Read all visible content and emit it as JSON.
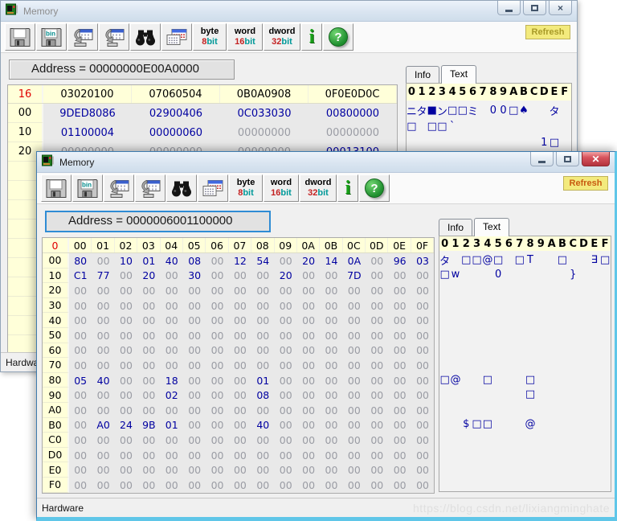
{
  "toolbar": {
    "bin_label": "bin",
    "byte": {
      "label": "byte",
      "num": "8",
      "unit": "bit"
    },
    "word": {
      "label": "word",
      "num": "16",
      "unit": "bit"
    },
    "dword": {
      "label": "dword",
      "num": "32",
      "unit": "bit"
    },
    "refresh_label": "Refresh"
  },
  "colors": {
    "value_navy": "#0000A0",
    "zero_gray": "#9A9CA4",
    "header_red": "#E00000",
    "header_bg_yellow": "#FFFFD9",
    "refresh_bg": "#F3EA7D",
    "focus_blue": "#2F8CD4"
  },
  "back_window": {
    "title": "Memory",
    "address": "Address = 00000000E00A0000",
    "tabs": {
      "info": "Info",
      "text": "Text"
    },
    "status": "Hardware",
    "table": {
      "addr_header": "16",
      "col_headers": [
        "03020100",
        "07060504",
        "0B0A0908",
        "0F0E0D0C"
      ],
      "rows": [
        {
          "addr": "00",
          "cells": [
            "9DED8086",
            "02900406",
            "0C033030",
            "00800000"
          ]
        },
        {
          "addr": "10",
          "cells": [
            "01100004",
            "00000060",
            "00000000",
            "00000000"
          ]
        },
        {
          "addr": "20",
          "cells": [
            "00000000",
            "00000000",
            "00000000",
            "00013100"
          ]
        },
        {
          "addr": "",
          "cells": [
            "",
            "",
            "",
            ""
          ]
        },
        {
          "addr": "",
          "cells": [
            "",
            "",
            "",
            ""
          ]
        },
        {
          "addr": "",
          "cells": [
            "",
            "",
            "",
            ""
          ]
        },
        {
          "addr": "",
          "cells": [
            "",
            "",
            "",
            ""
          ]
        },
        {
          "addr": "",
          "cells": [
            "",
            "",
            "",
            ""
          ]
        },
        {
          "addr": "",
          "cells": [
            "",
            "",
            "",
            ""
          ]
        },
        {
          "addr": "",
          "cells": [
            "",
            "",
            "",
            ""
          ]
        },
        {
          "addr": "",
          "cells": [
            "",
            "",
            "",
            ""
          ]
        },
        {
          "addr": "",
          "cells": [
            "",
            "",
            "",
            ""
          ]
        },
        {
          "addr": "",
          "cells": [
            "",
            "",
            "",
            ""
          ]
        }
      ]
    },
    "text_panel": {
      "header": "0123456789ABCDEF",
      "rows": [
        "ニタ■ン□□ミ 00□♠  タ ",
        "□ □□`           ",
        "             1□ "
      ]
    }
  },
  "front_window": {
    "title": "Memory",
    "address": "Address = 0000006001100000",
    "tabs": {
      "info": "Info",
      "text": "Text"
    },
    "status": "Hardware",
    "watermark": "https://blog.csdn.net/lixiangminghate",
    "table": {
      "addr_header": "0",
      "col_headers": [
        "00",
        "01",
        "02",
        "03",
        "04",
        "05",
        "06",
        "07",
        "08",
        "09",
        "0A",
        "0B",
        "0C",
        "0D",
        "0E",
        "0F"
      ],
      "rows": [
        {
          "addr": "00",
          "cells": [
            "80",
            "00",
            "10",
            "01",
            "40",
            "08",
            "00",
            "12",
            "54",
            "00",
            "20",
            "14",
            "0A",
            "00",
            "96",
            "03"
          ]
        },
        {
          "addr": "10",
          "cells": [
            "C1",
            "77",
            "00",
            "20",
            "00",
            "30",
            "00",
            "00",
            "00",
            "20",
            "00",
            "00",
            "7D",
            "00",
            "00",
            "00"
          ]
        },
        {
          "addr": "20",
          "cells": [
            "00",
            "00",
            "00",
            "00",
            "00",
            "00",
            "00",
            "00",
            "00",
            "00",
            "00",
            "00",
            "00",
            "00",
            "00",
            "00"
          ]
        },
        {
          "addr": "30",
          "cells": [
            "00",
            "00",
            "00",
            "00",
            "00",
            "00",
            "00",
            "00",
            "00",
            "00",
            "00",
            "00",
            "00",
            "00",
            "00",
            "00"
          ]
        },
        {
          "addr": "40",
          "cells": [
            "00",
            "00",
            "00",
            "00",
            "00",
            "00",
            "00",
            "00",
            "00",
            "00",
            "00",
            "00",
            "00",
            "00",
            "00",
            "00"
          ]
        },
        {
          "addr": "50",
          "cells": [
            "00",
            "00",
            "00",
            "00",
            "00",
            "00",
            "00",
            "00",
            "00",
            "00",
            "00",
            "00",
            "00",
            "00",
            "00",
            "00"
          ]
        },
        {
          "addr": "60",
          "cells": [
            "00",
            "00",
            "00",
            "00",
            "00",
            "00",
            "00",
            "00",
            "00",
            "00",
            "00",
            "00",
            "00",
            "00",
            "00",
            "00"
          ]
        },
        {
          "addr": "70",
          "cells": [
            "00",
            "00",
            "00",
            "00",
            "00",
            "00",
            "00",
            "00",
            "00",
            "00",
            "00",
            "00",
            "00",
            "00",
            "00",
            "00"
          ]
        },
        {
          "addr": "80",
          "cells": [
            "05",
            "40",
            "00",
            "00",
            "18",
            "00",
            "00",
            "00",
            "01",
            "00",
            "00",
            "00",
            "00",
            "00",
            "00",
            "00"
          ]
        },
        {
          "addr": "90",
          "cells": [
            "00",
            "00",
            "00",
            "00",
            "02",
            "00",
            "00",
            "00",
            "08",
            "00",
            "00",
            "00",
            "00",
            "00",
            "00",
            "00"
          ]
        },
        {
          "addr": "A0",
          "cells": [
            "00",
            "00",
            "00",
            "00",
            "00",
            "00",
            "00",
            "00",
            "00",
            "00",
            "00",
            "00",
            "00",
            "00",
            "00",
            "00"
          ]
        },
        {
          "addr": "B0",
          "cells": [
            "00",
            "A0",
            "24",
            "9B",
            "01",
            "00",
            "00",
            "00",
            "40",
            "00",
            "00",
            "00",
            "00",
            "00",
            "00",
            "00"
          ]
        },
        {
          "addr": "C0",
          "cells": [
            "00",
            "00",
            "00",
            "00",
            "00",
            "00",
            "00",
            "00",
            "00",
            "00",
            "00",
            "00",
            "00",
            "00",
            "00",
            "00"
          ]
        },
        {
          "addr": "D0",
          "cells": [
            "00",
            "00",
            "00",
            "00",
            "00",
            "00",
            "00",
            "00",
            "00",
            "00",
            "00",
            "00",
            "00",
            "00",
            "00",
            "00"
          ]
        },
        {
          "addr": "E0",
          "cells": [
            "00",
            "00",
            "00",
            "00",
            "00",
            "00",
            "00",
            "00",
            "00",
            "00",
            "00",
            "00",
            "00",
            "00",
            "00",
            "00"
          ]
        },
        {
          "addr": "F0",
          "cells": [
            "00",
            "00",
            "00",
            "00",
            "00",
            "00",
            "00",
            "00",
            "00",
            "00",
            "00",
            "00",
            "00",
            "00",
            "00",
            "00"
          ]
        }
      ]
    },
    "text_panel": {
      "header": "0123456789ABCDEF",
      "rows": [
        "タ □□@□ □T  □  ∃□",
        "□w   0      }   ",
        "                ",
        "                ",
        "                ",
        "                ",
        "                ",
        "                ",
        "□@  □   □       ",
        "        □       ",
        "                ",
        "  $□□   @       ",
        "                ",
        "                ",
        "                ",
        "                "
      ]
    }
  }
}
